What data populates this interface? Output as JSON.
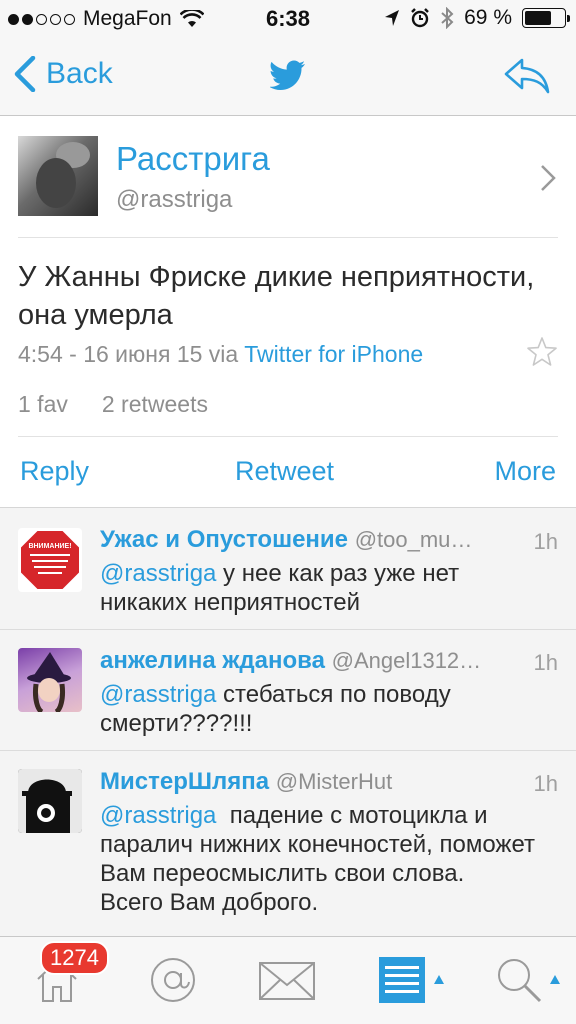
{
  "status_bar": {
    "carrier": "MegaFon",
    "time": "6:38",
    "battery": "69 %",
    "battery_level": 0.69,
    "signal_bars": 2
  },
  "nav": {
    "back_label": "Back",
    "icons": [
      "twitter-bird-icon",
      "reply-arrow-icon"
    ]
  },
  "author": {
    "name": "Расстрига",
    "handle": "@rasstriga"
  },
  "tweet": {
    "text": "У Жанны Фриске дикие неприятности, она умерла",
    "timestamp": "4:54 - 16 июня 15",
    "via_prefix": "via",
    "via_app": "Twitter for iPhone",
    "favs": "1 fav",
    "retweets": "2 retweets"
  },
  "actions": {
    "reply": "Reply",
    "retweet": "Retweet",
    "more": "More"
  },
  "replies": [
    {
      "name": "Ужас и Опустошение",
      "handle": "@too_mu…",
      "time": "1h",
      "mention": "@rasstriga",
      "text": " у нее как раз уже нет никаких неприятностей",
      "avatar_text": "ВНИМАНИЕ!"
    },
    {
      "name": "анжелина жданова",
      "handle": "@Angel1312…",
      "time": "1h",
      "mention": "@rasstriga",
      "text": " стебаться по поводу смерти????!!!"
    },
    {
      "name": "МистерШляпа",
      "handle": "@MisterHut",
      "time": "1h",
      "mention": "@rasstriga",
      "text": "  падение с мотоцикла и паралич нижних конечностей, поможет Вам переосмыслить свои слова.\nВсего Вам доброго."
    }
  ],
  "tabbar": {
    "badge": "1274",
    "tabs": [
      "home-icon",
      "mentions-icon",
      "messages-icon",
      "lists-icon",
      "search-icon"
    ],
    "active_tab": "lists-icon"
  },
  "colors": {
    "accent": "#2a9cdc",
    "badge": "#e8392f",
    "secondary_text": "#8e8e8e"
  }
}
